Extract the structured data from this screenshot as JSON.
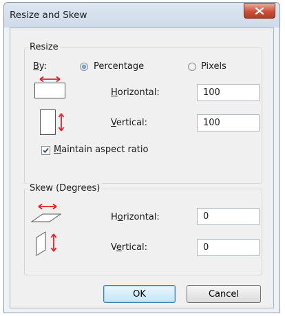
{
  "window": {
    "title": "Resize and Skew"
  },
  "resize": {
    "group_label": "Resize",
    "by_label": "By:",
    "percentage_label": "Percentage",
    "pixels_label": "Pixels",
    "selected_mode": "Percentage",
    "horizontal_label": "Horizontal:",
    "horizontal_value": "100",
    "vertical_label": "Vertical:",
    "vertical_value": "100",
    "maintain_aspect_label": "Maintain aspect ratio",
    "maintain_aspect_checked": true
  },
  "skew": {
    "group_label": "Skew (Degrees)",
    "horizontal_label": "Horizontal:",
    "horizontal_value": "0",
    "vertical_label": "Vertical:",
    "vertical_value": "0"
  },
  "buttons": {
    "ok_label": "OK",
    "cancel_label": "Cancel"
  },
  "colors": {
    "accent_arrow": "#e0222a",
    "close_button": "#c8503a"
  }
}
